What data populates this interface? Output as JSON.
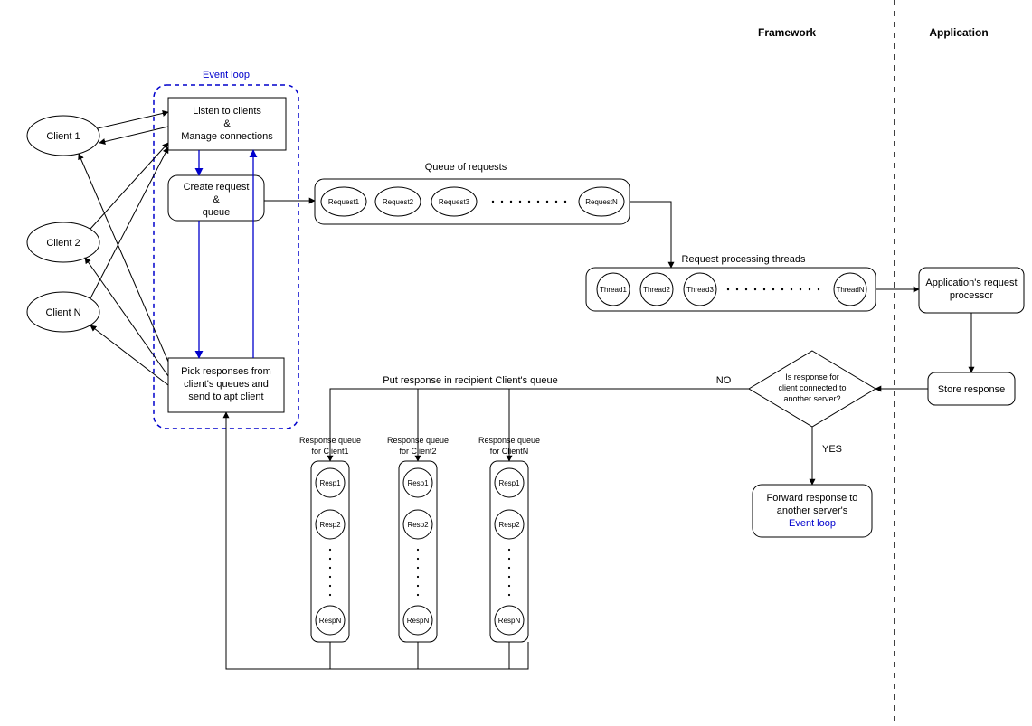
{
  "headers": {
    "framework": "Framework",
    "application": "Application"
  },
  "clients": {
    "c1": "Client 1",
    "c2": "Client 2",
    "cN": "Client N"
  },
  "eventLoop": {
    "title": "Event loop",
    "listen": {
      "l1": "Listen to clients",
      "amp": "&",
      "l2": "Manage connections"
    },
    "create": {
      "l1": "Create request",
      "amp": "&",
      "l2": "queue"
    },
    "pick": {
      "l1": "Pick responses from",
      "l2": "client's queues and",
      "l3": "send to apt client"
    }
  },
  "queueOfRequests": {
    "title": "Queue of requests",
    "items": [
      "Request1",
      "Request2",
      "Request3",
      "RequestN"
    ]
  },
  "threads": {
    "title": "Request processing threads",
    "items": [
      "Thread1",
      "Thread2",
      "Thread3",
      "ThreadN"
    ]
  },
  "appProcessor": {
    "l1": "Application's request",
    "l2": "processor"
  },
  "storeResponse": "Store response",
  "decision": {
    "l1": "Is response for",
    "l2": "client connected to",
    "l3": "another server?"
  },
  "decisionEdges": {
    "yes": "YES",
    "no": "NO"
  },
  "forward": {
    "l1": "Forward response to",
    "l2": "another server's",
    "l3": "Event loop"
  },
  "putResponseLabel": "Put response in recipient Client's queue",
  "respQueues": {
    "titles": {
      "l1": "Response queue",
      "c1": "for Client1",
      "c2": "for Client2",
      "cN": "for ClientN"
    },
    "items": [
      "Resp1",
      "Resp2",
      "RespN"
    ]
  }
}
